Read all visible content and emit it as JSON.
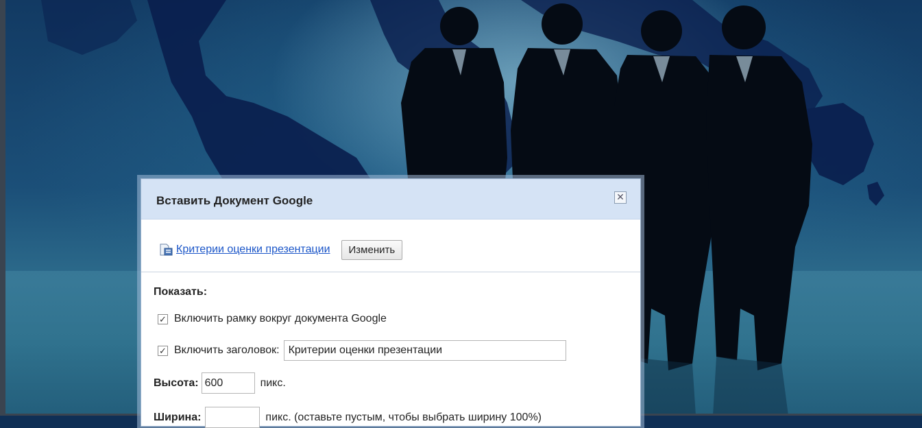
{
  "dialog": {
    "title": "Вставить Документ Google",
    "close_icon": "close-icon",
    "document": {
      "icon": "document-icon",
      "link_text": "Критерии оценки презентации"
    },
    "change_button": "Изменить",
    "show_label": "Показать:",
    "options": {
      "border": {
        "label": "Включить рамку вокруг документа Google",
        "checked": true
      },
      "title": {
        "label": "Включить заголовок:",
        "checked": true,
        "value": "Критерии оценки презентации"
      }
    },
    "height": {
      "label": "Высота:",
      "value": "600",
      "unit": "пикс."
    },
    "width": {
      "label": "Ширина:",
      "value": "",
      "unit": "пикс. (оставьте пустым, чтобы выбрать ширину 100%)"
    }
  },
  "colors": {
    "header_bg": "#d5e3f5",
    "link": "#1a55c8"
  }
}
